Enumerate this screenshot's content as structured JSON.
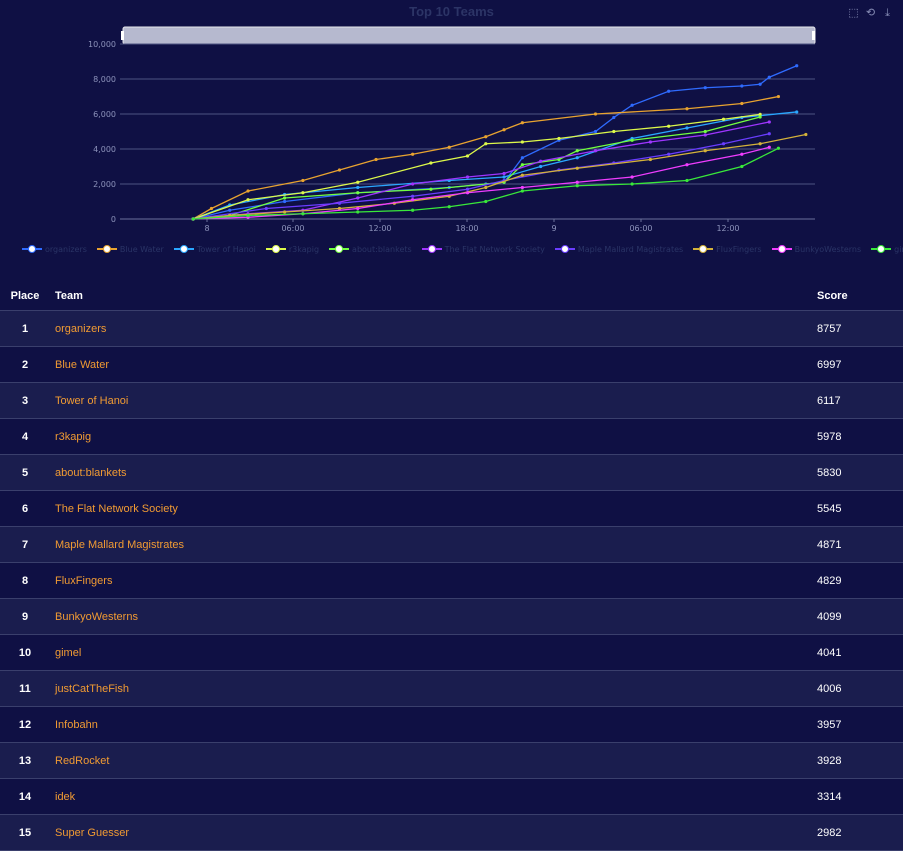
{
  "chart": {
    "title": "Top 10 Teams",
    "toolbox_icons": [
      "zoom-icon",
      "zoom-reset-icon",
      "download-icon"
    ]
  },
  "chart_data": {
    "type": "line",
    "title": "Top 10 Teams",
    "ylim": [
      0,
      10000
    ],
    "yticks": [
      "0",
      "2,000",
      "4,000",
      "6,000",
      "8,000",
      "10,000"
    ],
    "xticks": [
      "8",
      "06:00",
      "12:00",
      "18:00",
      "9",
      "06:00",
      "12:00"
    ],
    "xlim_hours": [
      -4,
      34
    ],
    "grid": true,
    "legend_position": "bottom",
    "series": [
      {
        "name": "organizers",
        "color": "#2f6bff",
        "x": [
          0,
          2,
          5,
          9,
          14,
          16,
          17,
          18,
          20,
          22,
          23,
          24,
          26,
          28,
          30,
          31,
          31.5,
          33
        ],
        "y": [
          0,
          500,
          1000,
          1500,
          1800,
          2000,
          2100,
          3500,
          4500,
          5000,
          5800,
          6500,
          7300,
          7500,
          7600,
          7700,
          8100,
          8757
        ]
      },
      {
        "name": "Blue Water",
        "color": "#e8a330",
        "x": [
          0,
          1,
          3,
          6,
          8,
          10,
          12,
          14,
          16,
          17,
          18,
          22,
          27,
          30,
          32
        ],
        "y": [
          0,
          600,
          1600,
          2200,
          2800,
          3400,
          3700,
          4100,
          4700,
          5100,
          5500,
          6000,
          6300,
          6600,
          6997
        ]
      },
      {
        "name": "Tower of Hanoi",
        "color": "#2aa7ff",
        "x": [
          0,
          2,
          5,
          9,
          14,
          17,
          19,
          21,
          24,
          27,
          30,
          33
        ],
        "y": [
          0,
          800,
          1400,
          1800,
          2200,
          2400,
          3000,
          3500,
          4600,
          5200,
          5800,
          6117
        ]
      },
      {
        "name": "r3kapig",
        "color": "#ddf94a",
        "x": [
          0,
          3,
          6,
          9,
          13,
          15,
          16,
          18,
          20,
          23,
          26,
          29,
          31
        ],
        "y": [
          0,
          1100,
          1500,
          2100,
          3200,
          3600,
          4300,
          4400,
          4600,
          5000,
          5300,
          5700,
          5978
        ]
      },
      {
        "name": "about:blankets",
        "color": "#72ff3f",
        "x": [
          0,
          2,
          5,
          9,
          13,
          17,
          18,
          20,
          21,
          24,
          28,
          31
        ],
        "y": [
          0,
          200,
          1200,
          1500,
          1700,
          2100,
          3100,
          3400,
          3900,
          4500,
          5000,
          5830
        ]
      },
      {
        "name": "The Flat Network Society",
        "color": "#9f35ff",
        "x": [
          0,
          3,
          6,
          9,
          12,
          15,
          17,
          19,
          22,
          25,
          28,
          31.5
        ],
        "y": [
          0,
          300,
          500,
          1200,
          2000,
          2400,
          2600,
          3300,
          3900,
          4400,
          4800,
          5545
        ]
      },
      {
        "name": "Maple Mallard Magistrates",
        "color": "#6a3dff",
        "x": [
          0,
          4,
          8,
          12,
          15,
          17,
          20,
          23,
          26,
          29,
          31.5
        ],
        "y": [
          0,
          600,
          900,
          1300,
          1700,
          2200,
          2800,
          3200,
          3700,
          4300,
          4871
        ]
      },
      {
        "name": "FluxFingers",
        "color": "#d4b23a",
        "x": [
          0,
          2,
          5,
          8,
          11,
          14,
          16,
          18,
          21,
          25,
          28,
          31,
          33.5
        ],
        "y": [
          0,
          200,
          400,
          600,
          900,
          1300,
          1800,
          2500,
          2900,
          3400,
          3900,
          4300,
          4829
        ]
      },
      {
        "name": "BunkyoWesterns",
        "color": "#f03dff",
        "x": [
          0,
          3,
          6,
          9,
          12,
          15,
          18,
          21,
          24,
          27,
          30,
          31.5
        ],
        "y": [
          0,
          100,
          300,
          600,
          1100,
          1500,
          1800,
          2100,
          2400,
          3100,
          3700,
          4099
        ]
      },
      {
        "name": "gimel",
        "color": "#39e83a",
        "x": [
          0,
          3,
          6,
          9,
          12,
          14,
          16,
          18,
          21,
          24,
          27,
          30,
          32
        ],
        "y": [
          0,
          200,
          300,
          400,
          500,
          700,
          1000,
          1600,
          1900,
          2000,
          2200,
          3000,
          4041
        ]
      }
    ]
  },
  "table": {
    "headers": {
      "place": "Place",
      "team": "Team",
      "score": "Score"
    },
    "rows": [
      {
        "place": "1",
        "team": "organizers",
        "score": "8757"
      },
      {
        "place": "2",
        "team": "Blue Water",
        "score": "6997"
      },
      {
        "place": "3",
        "team": "Tower of Hanoi",
        "score": "6117"
      },
      {
        "place": "4",
        "team": "r3kapig",
        "score": "5978"
      },
      {
        "place": "5",
        "team": "about:blankets",
        "score": "5830"
      },
      {
        "place": "6",
        "team": "The Flat Network Society",
        "score": "5545"
      },
      {
        "place": "7",
        "team": "Maple Mallard Magistrates",
        "score": "4871"
      },
      {
        "place": "8",
        "team": "FluxFingers",
        "score": "4829"
      },
      {
        "place": "9",
        "team": "BunkyoWesterns",
        "score": "4099"
      },
      {
        "place": "10",
        "team": "gimel",
        "score": "4041"
      },
      {
        "place": "11",
        "team": "justCatTheFish",
        "score": "4006"
      },
      {
        "place": "12",
        "team": "Infobahn",
        "score": "3957"
      },
      {
        "place": "13",
        "team": "RedRocket",
        "score": "3928"
      },
      {
        "place": "14",
        "team": "idek",
        "score": "3314"
      },
      {
        "place": "15",
        "team": "Super Guesser",
        "score": "2982"
      }
    ]
  }
}
